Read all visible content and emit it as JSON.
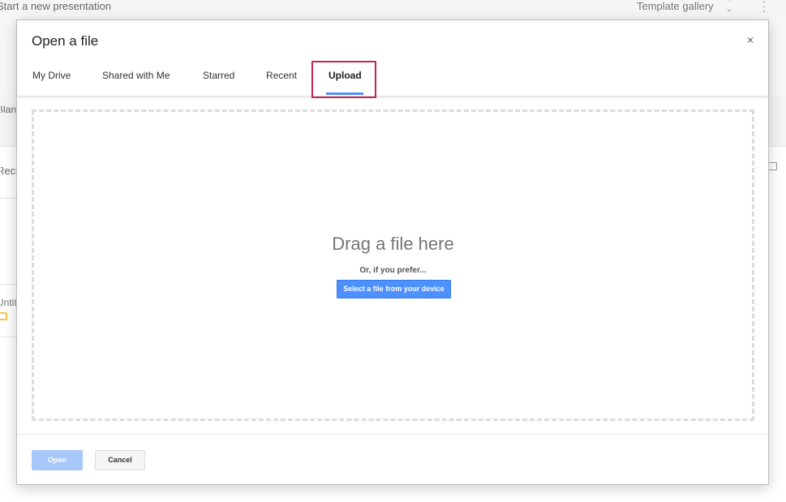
{
  "background": {
    "header_title": "Start a new presentation",
    "template_gallery_label": "Template gallery",
    "template_gallery_icon": "unfold-arrows-icon",
    "more_icon": "more-vert-icon",
    "blank_label": "Blank",
    "recent_label": "Recent",
    "untitled_label": "Untitled"
  },
  "dialog": {
    "title": "Open a file",
    "close_label": "×",
    "tabs": [
      {
        "label": "My Drive",
        "active": false
      },
      {
        "label": "Shared with Me",
        "active": false
      },
      {
        "label": "Starred",
        "active": false
      },
      {
        "label": "Recent",
        "active": false
      },
      {
        "label": "Upload",
        "active": true
      }
    ],
    "upload": {
      "drag_text": "Drag a file here",
      "prefer_text": "Or, if you prefer...",
      "select_button": "Select a file from your device"
    },
    "footer": {
      "open_label": "Open",
      "open_disabled": true,
      "cancel_label": "Cancel"
    },
    "highlight_color": "#c7254e",
    "accent_color": "#4d90fe"
  }
}
